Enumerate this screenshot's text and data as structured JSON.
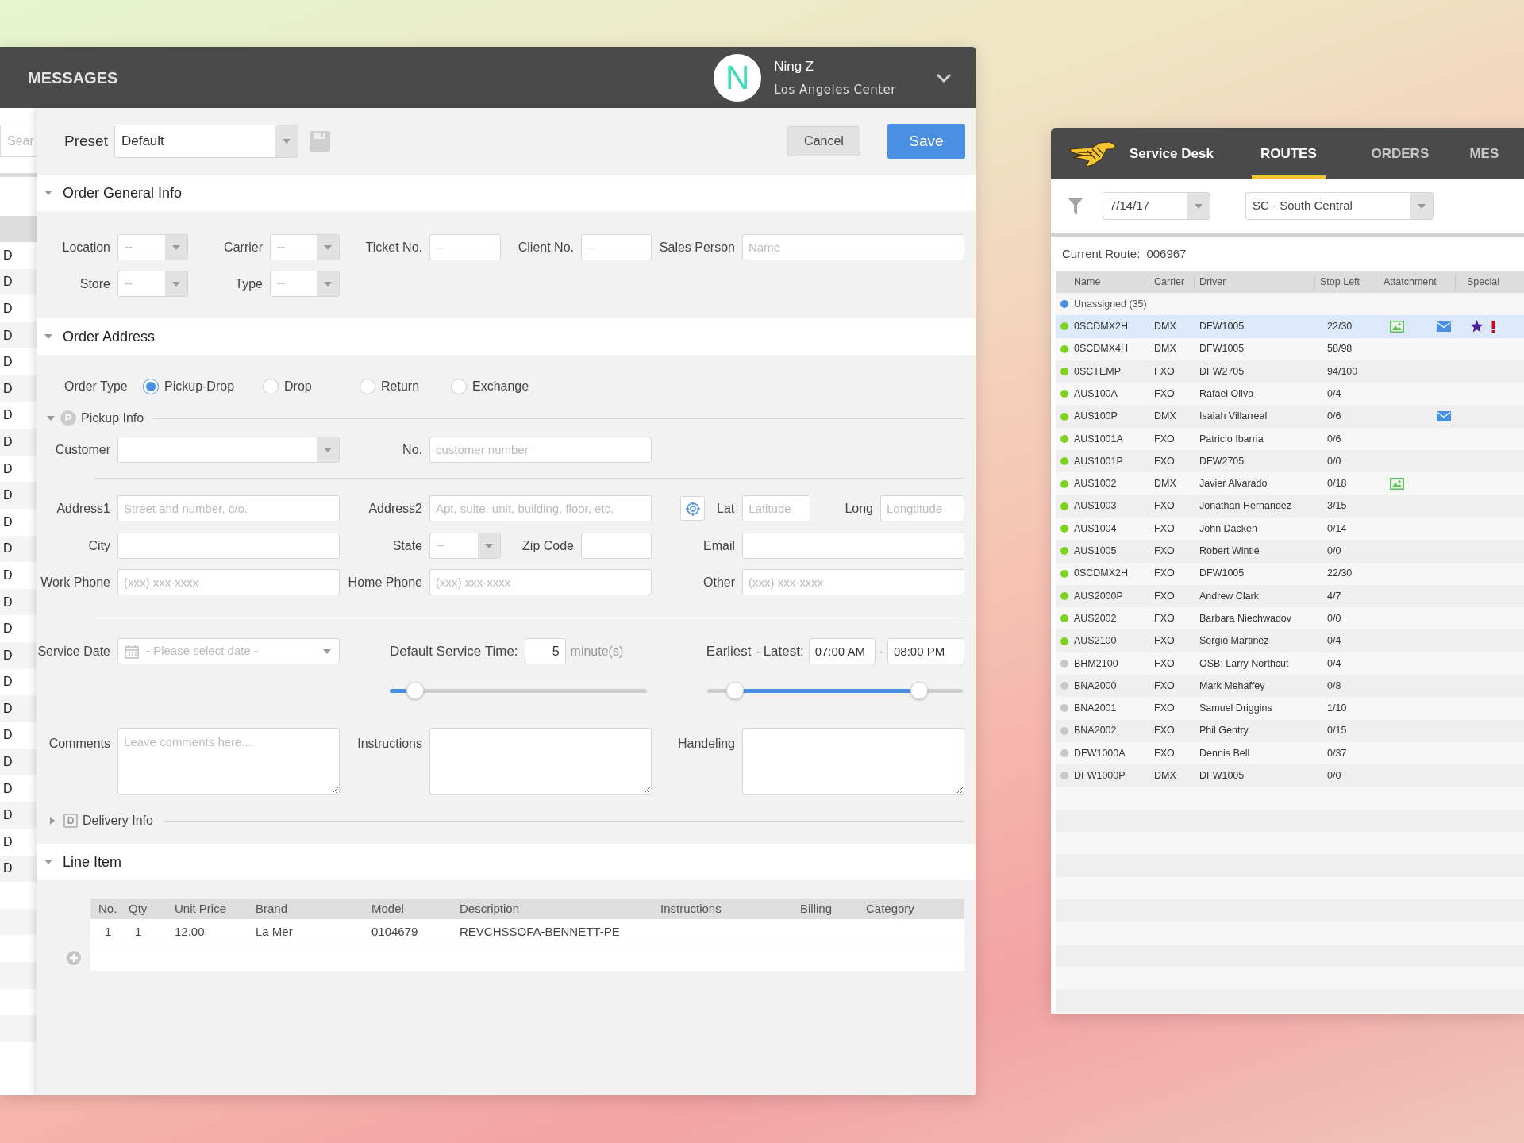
{
  "background_list": {
    "search_placeholder": "Sear",
    "rows": [
      "D",
      "D",
      "D",
      "D",
      "D",
      "D",
      "D",
      "D",
      "D",
      "D",
      "D",
      "D",
      "D",
      "D",
      "D",
      "D",
      "D",
      "D",
      "D",
      "D",
      "D",
      "D",
      "D",
      "D"
    ]
  },
  "messages_window": {
    "title": "MESSAGES",
    "user": {
      "initial": "N",
      "name": "Ning Z",
      "location": "Los Angeles Center"
    }
  },
  "order_form": {
    "preset": {
      "label": "Preset",
      "value": "Default"
    },
    "buttons": [
      {
        "label": "Cancel",
        "kind": "secondary"
      },
      {
        "label": "Save",
        "kind": "primary"
      }
    ],
    "general_info": {
      "title": "Order General Info",
      "expanded": true,
      "fields": [
        {
          "label": "Location",
          "kind": "select",
          "placeholder": "--"
        },
        {
          "label": "Carrier",
          "kind": "select",
          "placeholder": "--"
        },
        {
          "label": "Ticket No.",
          "kind": "input",
          "placeholder": "--"
        },
        {
          "label": "Client No.",
          "kind": "input",
          "placeholder": "--"
        },
        {
          "label": "Sales Person",
          "kind": "input",
          "placeholder": "Name"
        },
        {
          "label": "Store",
          "kind": "select",
          "placeholder": "--"
        },
        {
          "label": "Type",
          "kind": "select",
          "placeholder": "--"
        }
      ]
    },
    "address": {
      "title": "Order Address",
      "expanded": true,
      "order_type": {
        "label": "Order Type",
        "options": [
          {
            "label": "Pickup-Drop",
            "selected": true
          },
          {
            "label": "Drop",
            "selected": false
          },
          {
            "label": "Return",
            "selected": false
          },
          {
            "label": "Exchange",
            "selected": false
          }
        ]
      },
      "pickup": {
        "title": "Pickup Info",
        "badge": "P",
        "expanded": true,
        "customer": {
          "label": "Customer"
        },
        "number": {
          "label": "No.",
          "placeholder": "customer number"
        },
        "address1": {
          "label": "Address1",
          "placeholder": "Street and number, c/o."
        },
        "address2": {
          "label": "Address2",
          "placeholder": "Apt, suite, unit, building, floor, etc."
        },
        "lat": {
          "label": "Lat",
          "placeholder": "Latitude"
        },
        "long": {
          "label": "Long",
          "placeholder": "Longtitude"
        },
        "city": {
          "label": "City"
        },
        "state": {
          "label": "State",
          "placeholder": "--"
        },
        "zip": {
          "label": "Zip Code"
        },
        "email": {
          "label": "Email"
        },
        "work_phone": {
          "label": "Work Phone",
          "placeholder": "(xxx) xxx-xxxx"
        },
        "home_phone": {
          "label": "Home Phone",
          "placeholder": "(xxx) xxx-xxxx"
        },
        "other": {
          "label": "Other",
          "placeholder": "(xxx) xxx-xxxx"
        }
      },
      "service_date": {
        "label": "Service Date",
        "placeholder": "- Please select date -"
      },
      "service_time": {
        "label": "Default Service Time:",
        "value": "5",
        "unit": "minute(s)",
        "level": 0.1
      },
      "time_window": {
        "label": "Earliest - Latest:",
        "start": "07:00 AM",
        "separator": "-",
        "end": "08:00 PM",
        "range_start": {
          "level": 0.11
        },
        "range_end": {
          "level": 0.83
        }
      },
      "comments": {
        "label": "Comments",
        "placeholder": "Leave comments here..."
      },
      "instructions": {
        "label": "Instructions"
      },
      "handling": {
        "label": "Handeling"
      },
      "delivery": {
        "title": "Delivery Info",
        "badge": "D",
        "expanded": false
      }
    },
    "line_item": {
      "title": "Line Item",
      "expanded": true,
      "columns": [
        "No.",
        "Qty",
        "Unit Price",
        "Brand",
        "Model",
        "Description",
        "Instructions",
        "Billing",
        "Category"
      ],
      "rows": [
        [
          "1",
          "1",
          "12.00",
          "La Mer",
          "0104679",
          "REVCHSSOFA-BENNETT-PE"
        ]
      ]
    }
  },
  "routes_window": {
    "app_name": "Service Desk",
    "tabs": [
      {
        "label": "ROUTES",
        "selected": true
      },
      {
        "label": "ORDERS",
        "selected": false
      },
      {
        "label": "MES",
        "selected": false
      }
    ],
    "filter": {
      "date": "7/14/17",
      "region": "SC - South Central"
    },
    "current_route": {
      "label": "Current Route:",
      "value": "006967"
    },
    "columns": [
      "Name",
      "Carrier",
      "Driver",
      "Stop Left",
      "Attatchment",
      "Special"
    ],
    "group": {
      "label": "Unassigned (35)",
      "color": "#4a90e2"
    },
    "rows": [
      {
        "name": "0SCDMX2H",
        "carrier": "DMX",
        "driver": "DFW1005",
        "stops": "22/30",
        "color": "#7ed321",
        "selected": true,
        "attachments": [
          {
            "kind": "image"
          },
          {
            "kind": "mail"
          }
        ],
        "special": [
          {
            "kind": "star"
          },
          {
            "kind": "alert"
          }
        ]
      },
      {
        "name": "0SCDMX4H",
        "carrier": "DMX",
        "driver": "DFW1005",
        "stops": "58/98",
        "color": "#7ed321",
        "selected": false
      },
      {
        "name": "0SCTEMP",
        "carrier": "FXO",
        "driver": "DFW2705",
        "stops": "94/100",
        "color": "#7ed321",
        "selected": false
      },
      {
        "name": "AUS100A",
        "carrier": "FXO",
        "driver": "Rafael Oliva",
        "stops": "0/4",
        "color": "#7ed321",
        "selected": false
      },
      {
        "name": "AUS100P",
        "carrier": "DMX",
        "driver": "Isaiah Villarreal",
        "stops": "0/6",
        "color": "#7ed321",
        "selected": false,
        "attachments": [
          {
            "kind": "mail"
          }
        ]
      },
      {
        "name": "AUS1001A",
        "carrier": "FXO",
        "driver": "Patricio Ibarria",
        "stops": "0/6",
        "color": "#7ed321",
        "selected": false
      },
      {
        "name": "AUS1001P",
        "carrier": "FXO",
        "driver": "DFW2705",
        "stops": "0/0",
        "color": "#7ed321",
        "selected": false
      },
      {
        "name": "AUS1002",
        "carrier": "DMX",
        "driver": "Javier Alvarado",
        "stops": "0/18",
        "color": "#7ed321",
        "selected": false,
        "attachments": [
          {
            "kind": "image"
          }
        ]
      },
      {
        "name": "AUS1003",
        "carrier": "FXO",
        "driver": "Jonathan Hernandez",
        "stops": "3/15",
        "color": "#7ed321",
        "selected": false
      },
      {
        "name": "AUS1004",
        "carrier": "FXO",
        "driver": "John Dacken",
        "stops": "0/14",
        "color": "#7ed321",
        "selected": false
      },
      {
        "name": "AUS1005",
        "carrier": "FXO",
        "driver": "Robert Wintle",
        "stops": "0/0",
        "color": "#7ed321",
        "selected": false
      },
      {
        "name": "0SCDMX2H",
        "carrier": "FXO",
        "driver": "DFW1005",
        "stops": "22/30",
        "color": "#7ed321",
        "selected": false
      },
      {
        "name": "AUS2000P",
        "carrier": "FXO",
        "driver": "Andrew Clark",
        "stops": "4/7",
        "color": "#7ed321",
        "selected": false
      },
      {
        "name": "AUS2002",
        "carrier": "FXO",
        "driver": "Barbara Niechwadov",
        "stops": "0/0",
        "color": "#7ed321",
        "selected": false
      },
      {
        "name": "AUS2100",
        "carrier": "FXO",
        "driver": "Sergio Martinez",
        "stops": "0/4",
        "color": "#7ed321",
        "selected": false
      },
      {
        "name": "BHM2100",
        "carrier": "FXO",
        "driver": "OSB: Larry Northcut",
        "stops": "0/4",
        "color": "#c8c8c8",
        "selected": false
      },
      {
        "name": "BNA2000",
        "carrier": "FXO",
        "driver": "Mark Mehaffey",
        "stops": "0/8",
        "color": "#c8c8c8",
        "selected": false
      },
      {
        "name": "BNA2001",
        "carrier": "FXO",
        "driver": "Samuel Driggins",
        "stops": "1/10",
        "color": "#c8c8c8",
        "selected": false
      },
      {
        "name": "BNA2002",
        "carrier": "FXO",
        "driver": "Phil Gentry",
        "stops": "0/15",
        "color": "#c8c8c8",
        "selected": false
      },
      {
        "name": "DFW1000A",
        "carrier": "FXO",
        "driver": "Dennis Bell",
        "stops": "0/37",
        "color": "#c8c8c8",
        "selected": false
      },
      {
        "name": "DFW1000P",
        "carrier": "DMX",
        "driver": "DFW1005",
        "stops": "0/0",
        "color": "#c8c8c8",
        "selected": false
      }
    ]
  }
}
